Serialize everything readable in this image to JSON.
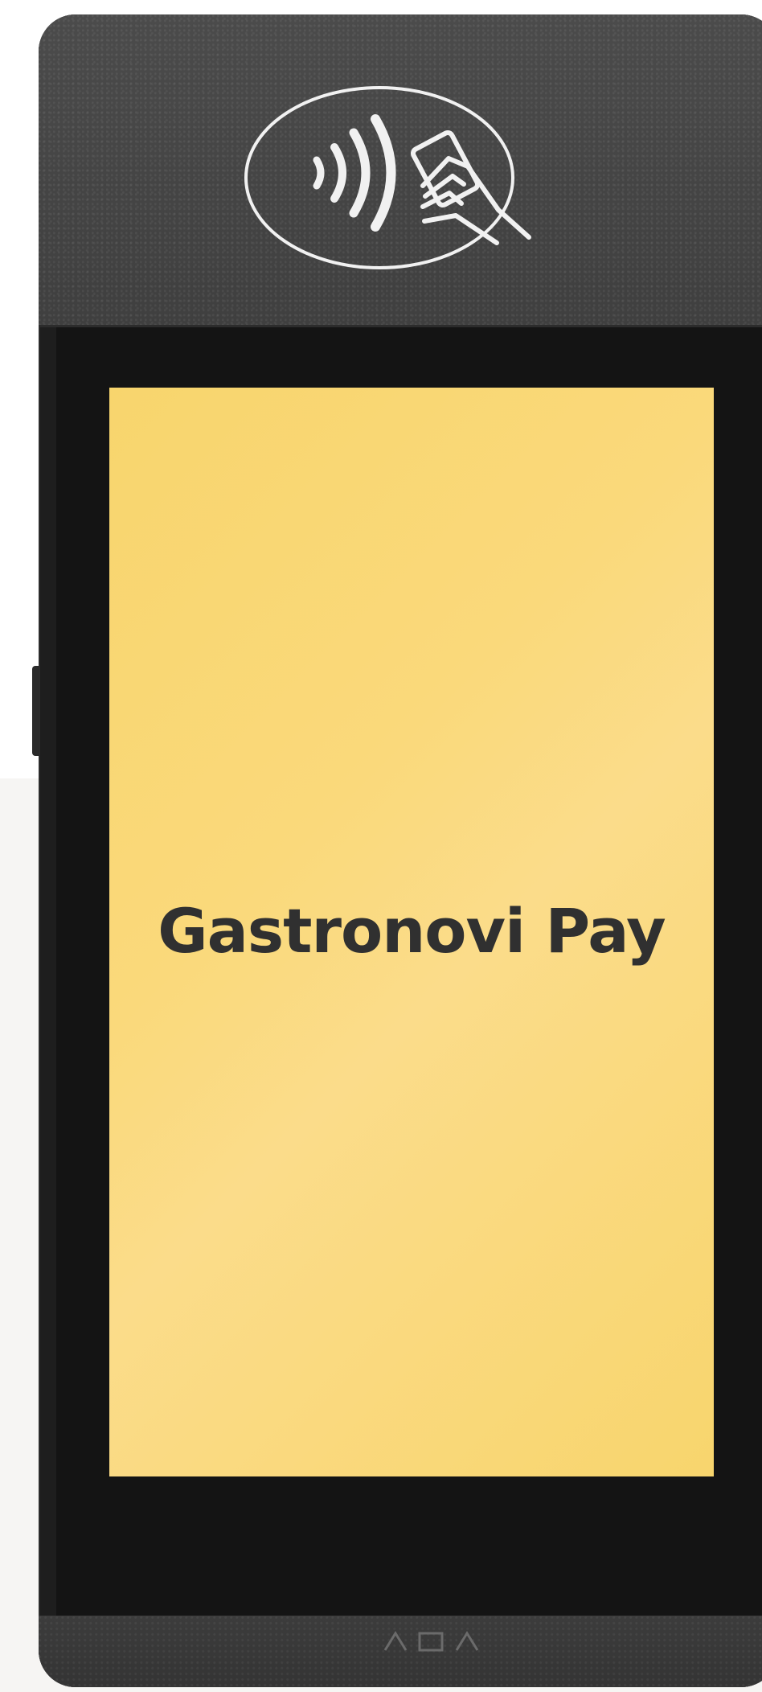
{
  "screen": {
    "title": "Gastronovi Pay"
  },
  "icons": {
    "contactless": "contactless-card-tap-icon"
  },
  "colors": {
    "screen_background": "#f9d878",
    "title_text": "#303030",
    "device_body": "#1e1e1e",
    "reader_surface": "#454545",
    "page_background": "#f6f5f3"
  }
}
